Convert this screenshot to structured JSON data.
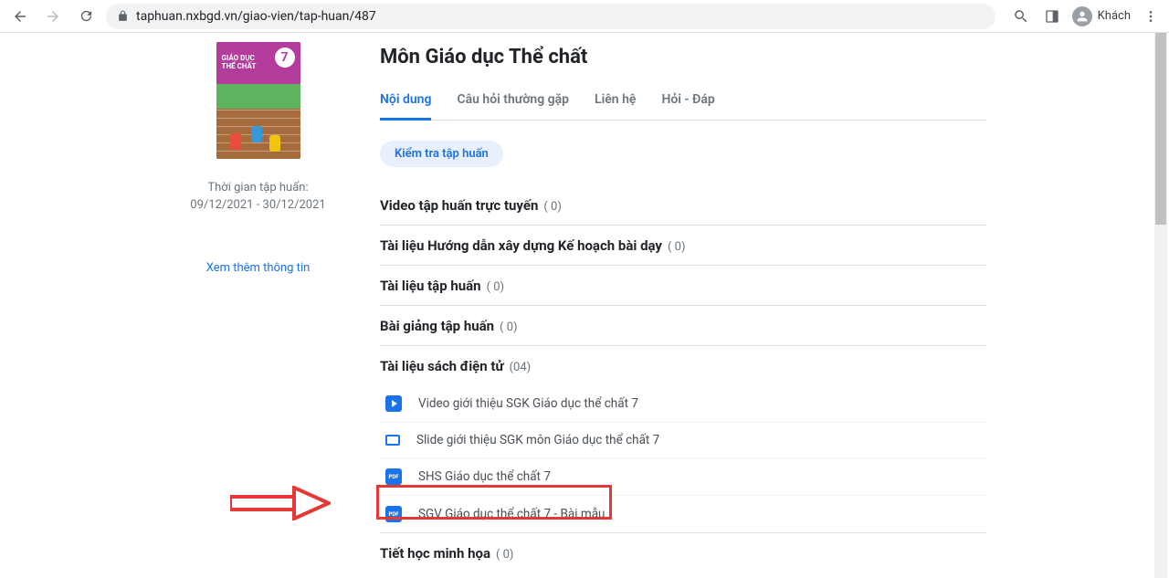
{
  "chrome": {
    "url": "taphuan.nxbgd.vn/giao-vien/tap-huan/487",
    "guest_label": "Khách"
  },
  "sidebar": {
    "book_title": "GIÁO DỤC\nTHỂ CHẤT",
    "book_number": "7",
    "period_label": "Thời gian tập huấn:",
    "period_value": "09/12/2021 - 30/12/2021",
    "more_link": "Xem thêm thông tin"
  },
  "main": {
    "title": "Môn Giáo dục Thể chất",
    "tabs": [
      {
        "label": "Nội dung",
        "active": true
      },
      {
        "label": "Câu hỏi thường gặp",
        "active": false
      },
      {
        "label": "Liên hệ",
        "active": false
      },
      {
        "label": "Hỏi - Đáp",
        "active": false
      }
    ],
    "test_chip": "Kiểm tra tập huấn",
    "sections": [
      {
        "title": "Video tập huấn trực tuyến",
        "count": "( 0)"
      },
      {
        "title": "Tài liệu Hướng dẫn xây dựng Kế hoạch bài dạy",
        "count": "( 0)"
      },
      {
        "title": "Tài liệu tập huấn",
        "count": "( 0)"
      },
      {
        "title": "Bài giảng tập huấn",
        "count": "( 0)"
      },
      {
        "title": "Tài liệu sách điện tử",
        "count": "(04)",
        "items": [
          {
            "icon": "video",
            "label": "Video giới thiệu SGK Giáo dục thể chất 7"
          },
          {
            "icon": "slide",
            "label": "Slide giới thiệu SGK môn Giáo dục thể chất 7"
          },
          {
            "icon": "pdf",
            "label": "SHS Giáo dục thể chất 7"
          },
          {
            "icon": "pdf",
            "label": "SGV Giáo dục thể chất 7 - Bài mẫu"
          }
        ]
      },
      {
        "title": "Tiết học minh họa",
        "count": "( 0)"
      }
    ]
  }
}
